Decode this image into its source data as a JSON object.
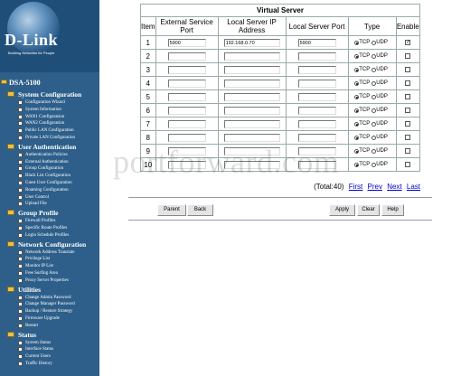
{
  "brand": {
    "name": "D-Link",
    "tagline": "Building Networks for People"
  },
  "sidebar": {
    "model": "DSA-5100",
    "groups": [
      {
        "label": "System Configuration",
        "items": [
          "Configuration Wizard",
          "System Information",
          "WAN1 Configuration",
          "WAN2 Configuration",
          "Public LAN Configuration",
          "Private LAN Configuration"
        ]
      },
      {
        "label": "User Authentication",
        "items": [
          "Authentication Policies",
          "External Authentication",
          "Group Configuration",
          "Black List Configuration",
          "Guest User Configuration",
          "Roaming Configuration",
          "User Control",
          "Upload File"
        ]
      },
      {
        "label": "Group Profile",
        "items": [
          "Firewall Profiles",
          "Specific Route Profiles",
          "Login Schedule Profiles"
        ]
      },
      {
        "label": "Network Configuration",
        "items": [
          "Network Address Translate",
          "Privilege List",
          "Monitor IP List",
          "Free Surfing Area",
          "Proxy Server Properties"
        ]
      },
      {
        "label": "Utilities",
        "items": [
          "Change Admin Password",
          "Change Manager Password",
          "Backup / Restore Strategy",
          "Firmware Upgrade",
          "Restart"
        ]
      },
      {
        "label": "Status",
        "items": [
          "System Status",
          "Interface Status",
          "Current Users",
          "Traffic History"
        ]
      }
    ]
  },
  "table": {
    "title": "Virtual Server",
    "headers": {
      "item": "Item",
      "ext": "External Service Port",
      "local_ip": "Local Server IP Address",
      "local_port": "Local Server Port",
      "type": "Type",
      "enable": "Enable"
    },
    "tcp": "TCP",
    "udp": "UDP",
    "rows": [
      {
        "no": "1",
        "ext": "5900",
        "ip": "192.168.0.70",
        "port": "5900",
        "type": "TCP",
        "enabled": true
      },
      {
        "no": "2",
        "ext": "",
        "ip": "",
        "port": "",
        "type": "TCP",
        "enabled": false
      },
      {
        "no": "3",
        "ext": "",
        "ip": "",
        "port": "",
        "type": "TCP",
        "enabled": false
      },
      {
        "no": "4",
        "ext": "",
        "ip": "",
        "port": "",
        "type": "TCP",
        "enabled": false
      },
      {
        "no": "5",
        "ext": "",
        "ip": "",
        "port": "",
        "type": "TCP",
        "enabled": false
      },
      {
        "no": "6",
        "ext": "",
        "ip": "",
        "port": "",
        "type": "TCP",
        "enabled": false
      },
      {
        "no": "7",
        "ext": "",
        "ip": "",
        "port": "",
        "type": "TCP",
        "enabled": false
      },
      {
        "no": "8",
        "ext": "",
        "ip": "",
        "port": "",
        "type": "TCP",
        "enabled": false
      },
      {
        "no": "9",
        "ext": "",
        "ip": "",
        "port": "",
        "type": "TCP",
        "enabled": false
      },
      {
        "no": "10",
        "ext": "",
        "ip": "",
        "port": "",
        "type": "TCP",
        "enabled": false
      }
    ]
  },
  "paging": {
    "total": "(Total:40)",
    "first": "First",
    "prev": "Prev",
    "next": "Next",
    "last": "Last"
  },
  "buttons": {
    "parent": "Parent",
    "back": "Back",
    "apply": "Apply",
    "clear": "Clear",
    "help": "Help"
  },
  "watermark": "portforward.com",
  "colors": {
    "sidebar": "#2d5f8a",
    "link": "#0000cc"
  }
}
